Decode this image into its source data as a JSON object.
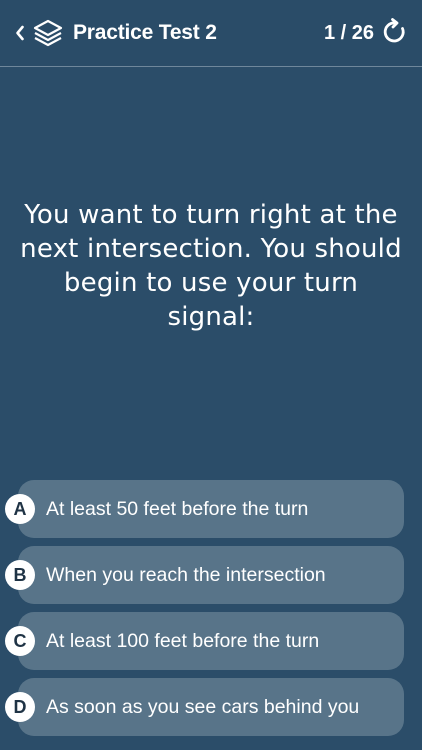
{
  "header": {
    "title": "Practice Test 2",
    "progress": "1 / 26",
    "icons": [
      "chevron-left-icon",
      "layers-icon",
      "refresh-icon"
    ]
  },
  "question": {
    "text": "You want to turn right at the next intersection. You should begin to use your turn signal:"
  },
  "answers": [
    {
      "letter": "A",
      "text": "At least 50 feet before the turn"
    },
    {
      "letter": "B",
      "text": "When you reach the intersection"
    },
    {
      "letter": "C",
      "text": "At least 100 feet before the turn"
    },
    {
      "letter": "D",
      "text": "As soon as you see cars behind you"
    }
  ],
  "colors": {
    "background": "#2b4d69",
    "answer_bg": "#587489",
    "letter_bg": "#ffffff",
    "divider": "#6f879b"
  }
}
